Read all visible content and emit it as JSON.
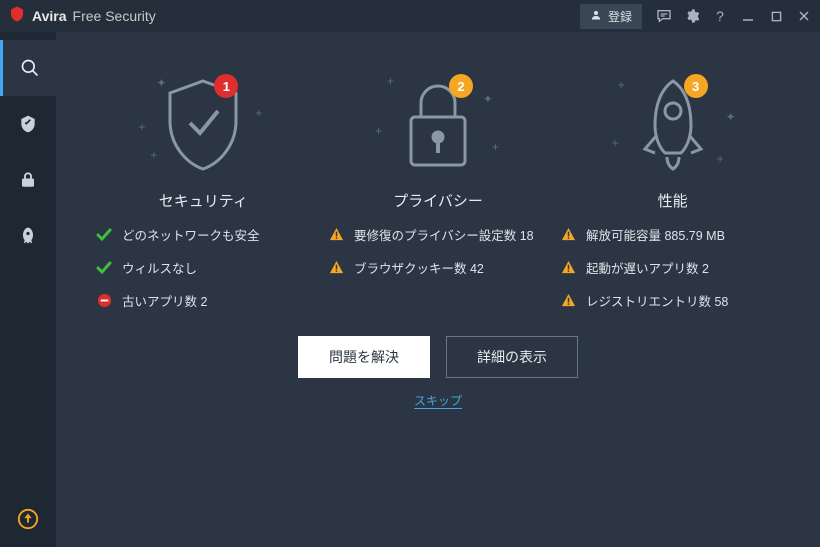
{
  "titlebar": {
    "brand_bold": "Avira",
    "brand_light": "Free Security",
    "register": "登録"
  },
  "cards": {
    "security": {
      "title": "セキュリティ",
      "badge": "1",
      "badge_color": "red"
    },
    "privacy": {
      "title": "プライバシー",
      "badge": "2",
      "badge_color": "orange"
    },
    "performance": {
      "title": "性能",
      "badge": "3",
      "badge_color": "orange"
    }
  },
  "status": {
    "security": [
      {
        "icon": "ok",
        "text": "どのネットワークも安全"
      },
      {
        "icon": "ok",
        "text": "ウィルスなし"
      },
      {
        "icon": "err",
        "text": "古いアプリ数 2"
      }
    ],
    "privacy": [
      {
        "icon": "warn",
        "text": "要修復のプライバシー設定数 18"
      },
      {
        "icon": "warn",
        "text": "ブラウザクッキー数 42"
      }
    ],
    "performance": [
      {
        "icon": "warn",
        "text": "解放可能容量 885.79 MB"
      },
      {
        "icon": "warn",
        "text": "起動が遅いアプリ数 2"
      },
      {
        "icon": "warn",
        "text": "レジストリエントリ数 58"
      }
    ]
  },
  "actions": {
    "fix": "問題を解決",
    "details": "詳細の表示",
    "skip": "スキップ"
  }
}
